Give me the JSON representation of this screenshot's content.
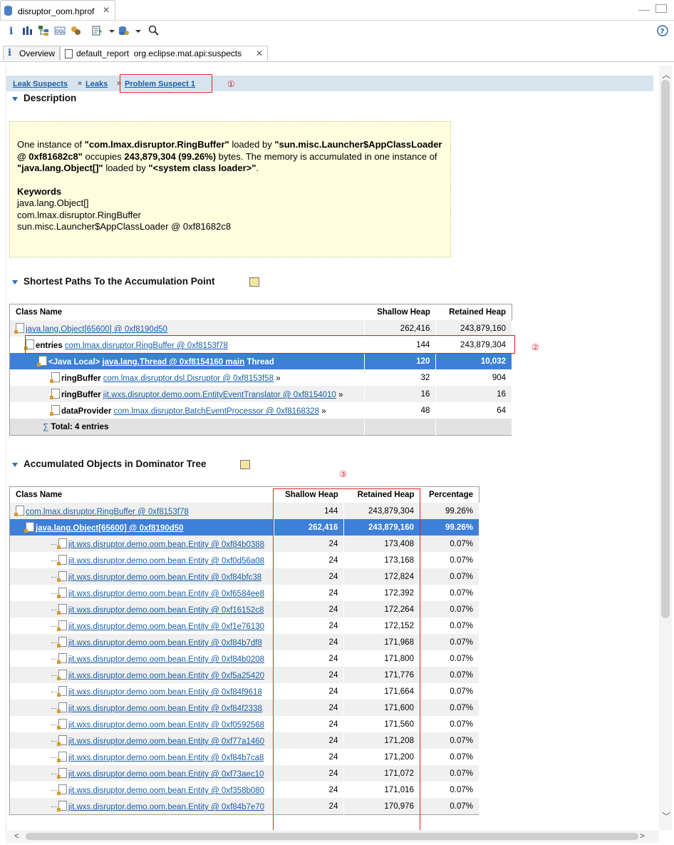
{
  "editor_tab": {
    "title": "disruptor_oom.hprof"
  },
  "sub_tabs": [
    {
      "label": "Overview"
    },
    {
      "label": "default_report  org.eclipse.mat.api:suspects"
    }
  ],
  "breadcrumb": [
    "Leak Suspects",
    "Leaks",
    "Problem Suspect 1"
  ],
  "annotations": [
    "①",
    "②",
    "③"
  ],
  "description": {
    "title": "Description",
    "text_parts": {
      "p1": "One instance of ",
      "b1": "\"com.lmax.disruptor.RingBuffer\"",
      "p2": " loaded by ",
      "b2": "\"sun.misc.Launcher$AppClassLoader @ 0xf81682c8\"",
      "p3": " occupies ",
      "b3": "243,879,304 (99.26%)",
      "p4": " bytes. The memory is accumulated in one instance of ",
      "b4": "\"java.lang.Object[]\"",
      "p5": " loaded by ",
      "b5": "\"<system class loader>\"",
      "p6": "."
    },
    "keywords_title": "Keywords",
    "keywords": [
      "java.lang.Object[]",
      "com.lmax.disruptor.RingBuffer",
      "sun.misc.Launcher$AppClassLoader @ 0xf81682c8"
    ]
  },
  "paths": {
    "title": "Shortest Paths To the Accumulation Point",
    "headers": [
      "Class Name",
      "Shallow Heap",
      "Retained Heap"
    ],
    "rows": [
      {
        "field": "",
        "link": "java.lang.Object[65600] @ 0xf8190d50",
        "suffix": "",
        "shallow": "262,416",
        "retained": "243,879,160"
      },
      {
        "field": "entries",
        "link": "com.lmax.disruptor.RingBuffer @ 0xf8153f78",
        "suffix": "",
        "shallow": "144",
        "retained": "243,879,304"
      },
      {
        "field": "<Java Local>",
        "link": "java.lang.Thread @ 0xf8154160 main",
        "suffix": "Thread",
        "shallow": "120",
        "retained": "10,032"
      },
      {
        "field": "ringBuffer",
        "link": "com.lmax.disruptor.dsl.Disruptor @ 0xf8153f58",
        "suffix": "»",
        "shallow": "32",
        "retained": "904"
      },
      {
        "field": "ringBuffer",
        "link": "jit.wxs.disruptor.demo.oom.EntityEventTranslator @ 0xf8154010",
        "suffix": "»",
        "shallow": "16",
        "retained": "16"
      },
      {
        "field": "dataProvider",
        "link": "com.lmax.disruptor.BatchEventProcessor @ 0xf8168328",
        "suffix": "»",
        "shallow": "48",
        "retained": "64"
      }
    ],
    "total": "Total: 4 entries"
  },
  "dominator": {
    "title": "Accumulated Objects in Dominator Tree",
    "headers": [
      "Class Name",
      "Shallow Heap",
      "Retained Heap",
      "Percentage"
    ],
    "rows": [
      {
        "name": "com.lmax.disruptor.RingBuffer @ 0xf8153f78",
        "shallow": "144",
        "retained": "243,879,304",
        "pct": "99.26%"
      },
      {
        "name": "java.lang.Object[65600] @ 0xf8190d50",
        "shallow": "262,416",
        "retained": "243,879,160",
        "pct": "99.26%"
      },
      {
        "name": "jit.wxs.disruptor.demo.oom.bean.Entity @ 0xf84b0388",
        "shallow": "24",
        "retained": "173,408",
        "pct": "0.07%"
      },
      {
        "name": "jit.wxs.disruptor.demo.oom.bean.Entity @ 0xf0d56a08",
        "shallow": "24",
        "retained": "173,168",
        "pct": "0.07%"
      },
      {
        "name": "jit.wxs.disruptor.demo.oom.bean.Entity @ 0xf84bfc38",
        "shallow": "24",
        "retained": "172,824",
        "pct": "0.07%"
      },
      {
        "name": "jit.wxs.disruptor.demo.oom.bean.Entity @ 0xf6584ee8",
        "shallow": "24",
        "retained": "172,392",
        "pct": "0.07%"
      },
      {
        "name": "jit.wxs.disruptor.demo.oom.bean.Entity @ 0xf16152c8",
        "shallow": "24",
        "retained": "172,264",
        "pct": "0.07%"
      },
      {
        "name": "jit.wxs.disruptor.demo.oom.bean.Entity @ 0xf1e76130",
        "shallow": "24",
        "retained": "172,152",
        "pct": "0.07%"
      },
      {
        "name": "jit.wxs.disruptor.demo.oom.bean.Entity @ 0xf84b7df8",
        "shallow": "24",
        "retained": "171,968",
        "pct": "0.07%"
      },
      {
        "name": "jit.wxs.disruptor.demo.oom.bean.Entity @ 0xf84b0208",
        "shallow": "24",
        "retained": "171,800",
        "pct": "0.07%"
      },
      {
        "name": "jit.wxs.disruptor.demo.oom.bean.Entity @ 0xf5a25420",
        "shallow": "24",
        "retained": "171,776",
        "pct": "0.07%"
      },
      {
        "name": "jit.wxs.disruptor.demo.oom.bean.Entity @ 0xf84f9618",
        "shallow": "24",
        "retained": "171,664",
        "pct": "0.07%"
      },
      {
        "name": "jit.wxs.disruptor.demo.oom.bean.Entity @ 0xf84f2338",
        "shallow": "24",
        "retained": "171,600",
        "pct": "0.07%"
      },
      {
        "name": "jit.wxs.disruptor.demo.oom.bean.Entity @ 0xf0592568",
        "shallow": "24",
        "retained": "171,560",
        "pct": "0.07%"
      },
      {
        "name": "jit.wxs.disruptor.demo.oom.bean.Entity @ 0xf77a1460",
        "shallow": "24",
        "retained": "171,208",
        "pct": "0.07%"
      },
      {
        "name": "jit.wxs.disruptor.demo.oom.bean.Entity @ 0xf84b7ca8",
        "shallow": "24",
        "retained": "171,200",
        "pct": "0.07%"
      },
      {
        "name": "jit.wxs.disruptor.demo.oom.bean.Entity @ 0xf73aec10",
        "shallow": "24",
        "retained": "171,072",
        "pct": "0.07%"
      },
      {
        "name": "jit.wxs.disruptor.demo.oom.bean.Entity @ 0xf358b080",
        "shallow": "24",
        "retained": "171,016",
        "pct": "0.07%"
      },
      {
        "name": "jit.wxs.disruptor.demo.oom.bean.Entity @ 0xf84b7e70",
        "shallow": "24",
        "retained": "170,976",
        "pct": "0.07%"
      }
    ]
  },
  "colors": {
    "selection": "#3d7fd9",
    "link": "#1a5fa8",
    "breadcrumb_bg": "#d7e4ee",
    "description_bg": "#ffffe0",
    "annotation_red": "#e02020"
  },
  "toolbar_icons": [
    "info-icon",
    "histogram-icon",
    "dominator-tree-icon",
    "oql-icon",
    "thread-overview-icon",
    "run-report-icon",
    "query-browser-icon",
    "search-icon",
    "help-icon"
  ]
}
